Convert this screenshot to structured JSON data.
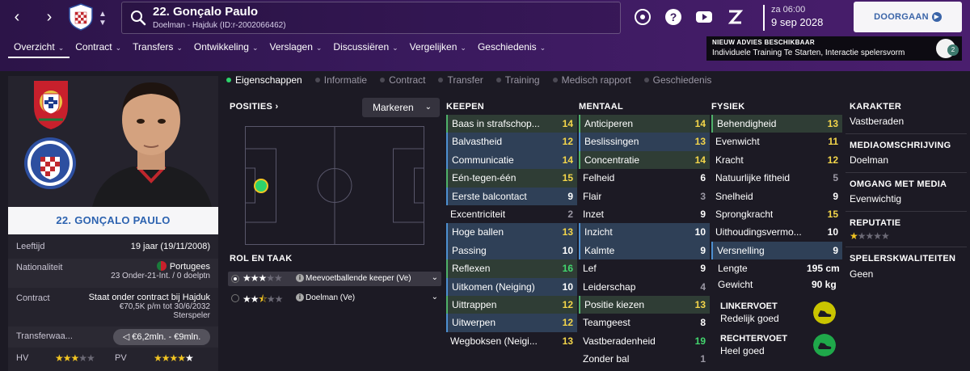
{
  "header": {
    "player_name": "22. Gonçalo Paulo",
    "player_sub": "Doelman - Hajduk (ID:r-2002066462)",
    "time": "za 06:00",
    "date": "9 sep 2028",
    "continue_label": "DOORGAAN",
    "advice_title": "NIEUW ADVIES BESCHIKBAAR",
    "advice_text": "Individuele Training Te Starten, Interactie spelersvorm",
    "advice_count": "2",
    "icons": [
      "back-arrow-icon",
      "forward-arrow-icon",
      "club-crest-icon",
      "search-icon",
      "fm-icon",
      "help-icon",
      "youtube-icon",
      "z-icon"
    ]
  },
  "menu": [
    {
      "label": "Overzicht"
    },
    {
      "label": "Contract"
    },
    {
      "label": "Transfers"
    },
    {
      "label": "Ontwikkeling"
    },
    {
      "label": "Verslagen"
    },
    {
      "label": "Discussiëren"
    },
    {
      "label": "Vergelijken"
    },
    {
      "label": "Geschiedenis"
    }
  ],
  "subtabs": [
    "Eigenschappen",
    "Informatie",
    "Contract",
    "Transfer",
    "Training",
    "Medisch rapport",
    "Geschiedenis"
  ],
  "profile": {
    "namebar": "22. GONÇALO PAULO",
    "age_label": "Leeftijd",
    "age_value": "19 jaar (19/11/2008)",
    "nat_label": "Nationaliteit",
    "nat_value": "Portugees",
    "nat_sub": "23 Onder-21-Int. / 0 doelptn",
    "contract_label": "Contract",
    "contract_l1": "Staat onder contract bij Hajduk",
    "contract_l2": "€70,5K p/m tot 30/6/2032",
    "contract_l3": "Sterspeler",
    "transfer_label": "Transferwaa...",
    "transfer_value": "€6,2mln. - €9mln.",
    "hv_label": "HV",
    "hv_stars": 3,
    "pv_label": "PV",
    "pv_stars": 5
  },
  "positions": {
    "title": "POSITIES",
    "mark_label": "Markeren",
    "role_title": "ROL EN TAAK",
    "roles": [
      {
        "name": "Meevoetballende keeper (Ve)",
        "stars": 3,
        "selected": true
      },
      {
        "name": "Doelman (Ve)",
        "stars": 2.5,
        "selected": false
      }
    ]
  },
  "keepen": {
    "title": "KEEPEN",
    "items": [
      {
        "name": "Baas in strafschop...",
        "value": "14",
        "hl": "green",
        "color": "yellow"
      },
      {
        "name": "Balvastheid",
        "value": "12",
        "hl": "blue",
        "color": "yellow"
      },
      {
        "name": "Communicatie",
        "value": "14",
        "hl": "blue",
        "color": "yellow"
      },
      {
        "name": "Eén-tegen-één",
        "value": "15",
        "hl": "green",
        "color": "yellow"
      },
      {
        "name": "Eerste balcontact",
        "value": "9",
        "hl": "blue",
        "color": "white"
      },
      {
        "name": "Excentriciteit",
        "value": "2",
        "hl": "",
        "color": "grey"
      },
      {
        "name": "Hoge ballen",
        "value": "13",
        "hl": "blue",
        "color": "yellow"
      },
      {
        "name": "Passing",
        "value": "10",
        "hl": "blue",
        "color": "white"
      },
      {
        "name": "Reflexen",
        "value": "16",
        "hl": "green",
        "color": "green"
      },
      {
        "name": "Uitkomen (Neiging)",
        "value": "10",
        "hl": "blue",
        "color": "white"
      },
      {
        "name": "Uittrappen",
        "value": "12",
        "hl": "green",
        "color": "yellow"
      },
      {
        "name": "Uitwerpen",
        "value": "12",
        "hl": "blue",
        "color": "yellow"
      },
      {
        "name": "Wegboksen (Neigi...",
        "value": "13",
        "hl": "",
        "color": "yellow"
      }
    ]
  },
  "mentaal": {
    "title": "MENTAAL",
    "items": [
      {
        "name": "Anticiperen",
        "value": "14",
        "hl": "green",
        "color": "yellow"
      },
      {
        "name": "Beslissingen",
        "value": "13",
        "hl": "blue",
        "color": "yellow"
      },
      {
        "name": "Concentratie",
        "value": "14",
        "hl": "green",
        "color": "yellow"
      },
      {
        "name": "Felheid",
        "value": "6",
        "hl": "",
        "color": "white"
      },
      {
        "name": "Flair",
        "value": "3",
        "hl": "",
        "color": "grey"
      },
      {
        "name": "Inzet",
        "value": "9",
        "hl": "",
        "color": "white"
      },
      {
        "name": "Inzicht",
        "value": "10",
        "hl": "blue",
        "color": "white"
      },
      {
        "name": "Kalmte",
        "value": "9",
        "hl": "blue",
        "color": "white"
      },
      {
        "name": "Lef",
        "value": "9",
        "hl": "",
        "color": "white"
      },
      {
        "name": "Leiderschap",
        "value": "4",
        "hl": "",
        "color": "grey"
      },
      {
        "name": "Positie kiezen",
        "value": "13",
        "hl": "green",
        "color": "yellow"
      },
      {
        "name": "Teamgeest",
        "value": "8",
        "hl": "",
        "color": "white"
      },
      {
        "name": "Vastberadenheid",
        "value": "19",
        "hl": "",
        "color": "green"
      },
      {
        "name": "Zonder bal",
        "value": "1",
        "hl": "",
        "color": "grey"
      }
    ]
  },
  "fysiek": {
    "title": "FYSIEK",
    "items": [
      {
        "name": "Behendigheid",
        "value": "13",
        "hl": "green",
        "color": "yellow"
      },
      {
        "name": "Evenwicht",
        "value": "11",
        "hl": "",
        "color": "yellow"
      },
      {
        "name": "Kracht",
        "value": "12",
        "hl": "",
        "color": "yellow"
      },
      {
        "name": "Natuurlijke fitheid",
        "value": "5",
        "hl": "",
        "color": "grey"
      },
      {
        "name": "Snelheid",
        "value": "9",
        "hl": "",
        "color": "white"
      },
      {
        "name": "Sprongkracht",
        "value": "15",
        "hl": "",
        "color": "yellow"
      },
      {
        "name": "Uithoudingsvermo...",
        "value": "10",
        "hl": "",
        "color": "white"
      },
      {
        "name": "Versnelling",
        "value": "9",
        "hl": "blue",
        "color": "white"
      }
    ],
    "length_label": "Lengte",
    "length_value": "195 cm",
    "weight_label": "Gewicht",
    "weight_value": "90 kg",
    "left_foot_label": "LINKERVOET",
    "left_foot_value": "Redelijk goed",
    "right_foot_label": "RECHTERVOET",
    "right_foot_value": "Heel goed",
    "left_foot_color": "#c9c400",
    "right_foot_color": "#1fa84a"
  },
  "right": {
    "karakter_label": "KARAKTER",
    "karakter_value": "Vastberaden",
    "media_label": "MEDIAOMSCHRIJVING",
    "media_value": "Doelman",
    "omgang_label": "OMGANG MET MEDIA",
    "omgang_value": "Evenwichtig",
    "reputatie_label": "REPUTATIE",
    "reputatie_stars": 1,
    "kwal_label": "SPELERSKWALITEITEN",
    "kwal_value": "Geen"
  },
  "colors": {
    "accent_blue": "#2d63b0",
    "header_purple": "#3a1a5e",
    "good_green": "#43d66e",
    "mid_yellow": "#f4d64a"
  }
}
